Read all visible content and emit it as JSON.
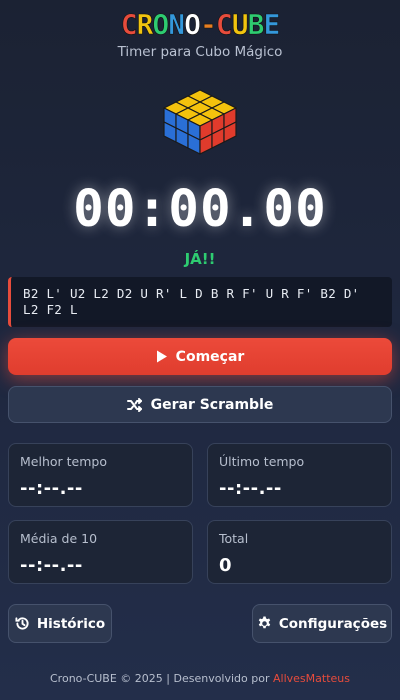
{
  "app": {
    "logo_text": "CRONO-CUBE",
    "subtitle": "Timer para Cubo Mágico"
  },
  "colors": {
    "accent": "#e74c3c",
    "ready": "#2ecc71",
    "background": "#1f2840",
    "card": "#1d2536"
  },
  "timer": {
    "display": "00:00.00",
    "status": "JÁ!!"
  },
  "scramble": {
    "text": "B2 L' U2 L2 D2 U R' L D B R F' U R F' B2 D' L2 F2 L"
  },
  "actions": {
    "start_label": "Começar",
    "start_icon": "play-icon",
    "scramble_label": "Gerar Scramble",
    "scramble_icon": "shuffle-icon"
  },
  "stats": {
    "best": {
      "label": "Melhor tempo",
      "value": "--:--.--"
    },
    "last": {
      "label": "Último tempo",
      "value": "--:--.--"
    },
    "avg10": {
      "label": "Média de 10",
      "value": "--:--.--"
    },
    "total": {
      "label": "Total",
      "value": "0"
    }
  },
  "bottom_nav": {
    "history_label": "Histórico",
    "history_icon": "history-icon",
    "settings_label": "Configurações",
    "settings_icon": "gear-icon"
  },
  "footer": {
    "text": "Crono-CUBE © 2025 | Desenvolvido por ",
    "author": "AllvesMatteus"
  }
}
